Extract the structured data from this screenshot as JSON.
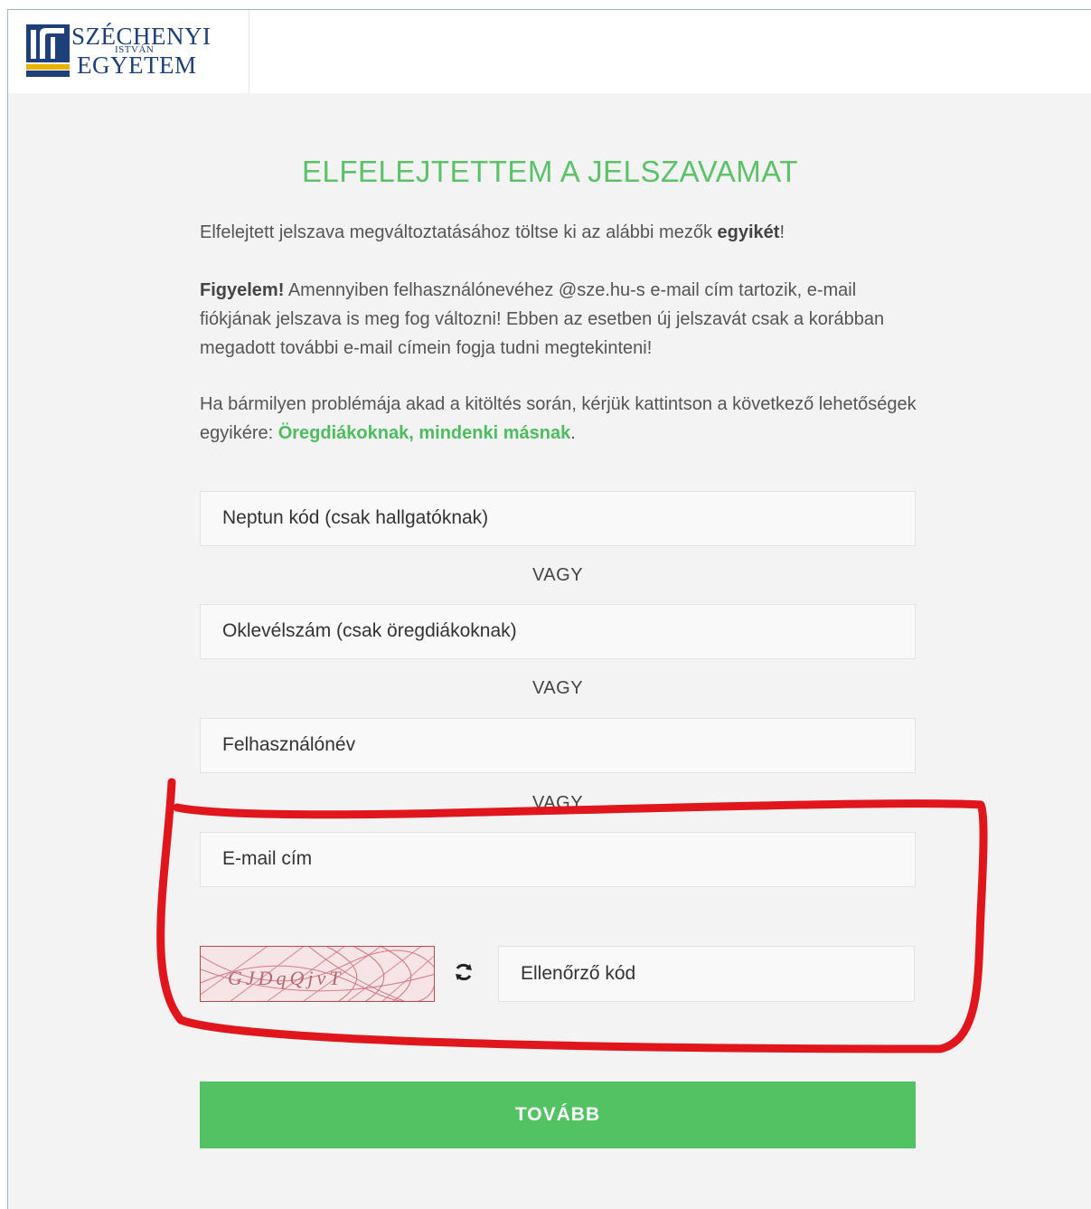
{
  "logo": {
    "line1": "SZÉCHENYI",
    "line2": "ISTVÁN",
    "line3": "EGYETEM"
  },
  "title": "ELFELEJTETTEM A JELSZAVAMAT",
  "intro": {
    "text": "Elfelejtett jelszava megváltoztatásához töltse ki az alábbi mezők ",
    "bold": "egyikét",
    "end": "!"
  },
  "warning": {
    "bold": "Figyelem!",
    "text": " Amennyiben felhasználónevéhez @sze.hu-s e-mail cím tartozik, e-mail fiókjának jelszava is meg fog változni! Ebben az esetben új jelszavát csak a korábban megadott további e-mail címein fogja tudni megtekinteni!"
  },
  "help": {
    "text": "Ha bármilyen problémája akad a kitöltés során, kérjük kattintson a következő lehetőségek egyikére: ",
    "link1": "Öregdiákoknak",
    "sep": ", ",
    "link2": "mindenki másnak",
    "end": "."
  },
  "fields": {
    "neptun": "Neptun kód (csak hallgatóknak)",
    "diploma": "Oklevélszám (csak öregdiákoknak)",
    "username": "Felhasználónév",
    "email": "E-mail cím",
    "captcha_code": "Ellenőrző kód"
  },
  "separator": "VAGY",
  "captcha_text": "GJDqQjvT",
  "submit_label": "TOVÁBB",
  "colors": {
    "accent": "#52c263",
    "annotation": "#e0161c",
    "logo": "#1d3f7a"
  }
}
